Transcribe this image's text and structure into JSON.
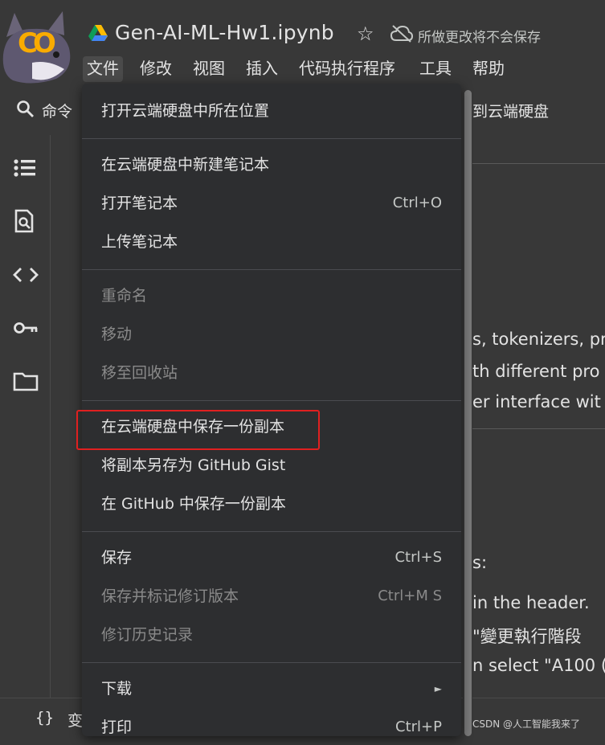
{
  "header": {
    "title": "Gen-AI-ML-Hw1.ipynb",
    "save_status": "所做更改将不会保存",
    "logo_text": "CO"
  },
  "menubar": [
    "文件",
    "修改",
    "视图",
    "插入",
    "代码执行程序",
    "工具",
    "帮助"
  ],
  "toolbar": {
    "command_label": "命令",
    "drive_copy_partial": "到云端硬盘"
  },
  "content": {
    "lines": [
      "s, tokenizers, pr",
      "th different pro",
      "er interface wit",
      "s:",
      "in the header.",
      "\"變更執行階段",
      "n select \"A100 ("
    ]
  },
  "bottom": {
    "braces": "{}",
    "var_label": "变",
    "watermark": "CSDN @人工智能我来了"
  },
  "file_menu": {
    "groups": [
      [
        {
          "label": "打开云端硬盘中所在位置",
          "shortcut": "",
          "disabled": false
        }
      ],
      [
        {
          "label": "在云端硬盘中新建笔记本",
          "shortcut": "",
          "disabled": false
        },
        {
          "label": "打开笔记本",
          "shortcut": "Ctrl+O",
          "disabled": false
        },
        {
          "label": "上传笔记本",
          "shortcut": "",
          "disabled": false
        }
      ],
      [
        {
          "label": "重命名",
          "shortcut": "",
          "disabled": true
        },
        {
          "label": "移动",
          "shortcut": "",
          "disabled": true
        },
        {
          "label": "移至回收站",
          "shortcut": "",
          "disabled": true
        }
      ],
      [
        {
          "label": "在云端硬盘中保存一份副本",
          "shortcut": "",
          "disabled": false
        },
        {
          "label": "将副本另存为 GitHub Gist",
          "shortcut": "",
          "disabled": false
        },
        {
          "label": "在 GitHub 中保存一份副本",
          "shortcut": "",
          "disabled": false
        }
      ],
      [
        {
          "label": "保存",
          "shortcut": "Ctrl+S",
          "disabled": false
        },
        {
          "label": "保存并标记修订版本",
          "shortcut": "Ctrl+M S",
          "disabled": true
        },
        {
          "label": "修订历史记录",
          "shortcut": "",
          "disabled": true
        }
      ],
      [
        {
          "label": "下载",
          "shortcut": "►",
          "disabled": false
        },
        {
          "label": "打印",
          "shortcut": "Ctrl+P",
          "disabled": false
        }
      ]
    ]
  },
  "colors": {
    "background": "#383838",
    "menu_background": "#2d2e30",
    "highlight": "#e02020",
    "logo_orange": "#f9ab00"
  }
}
